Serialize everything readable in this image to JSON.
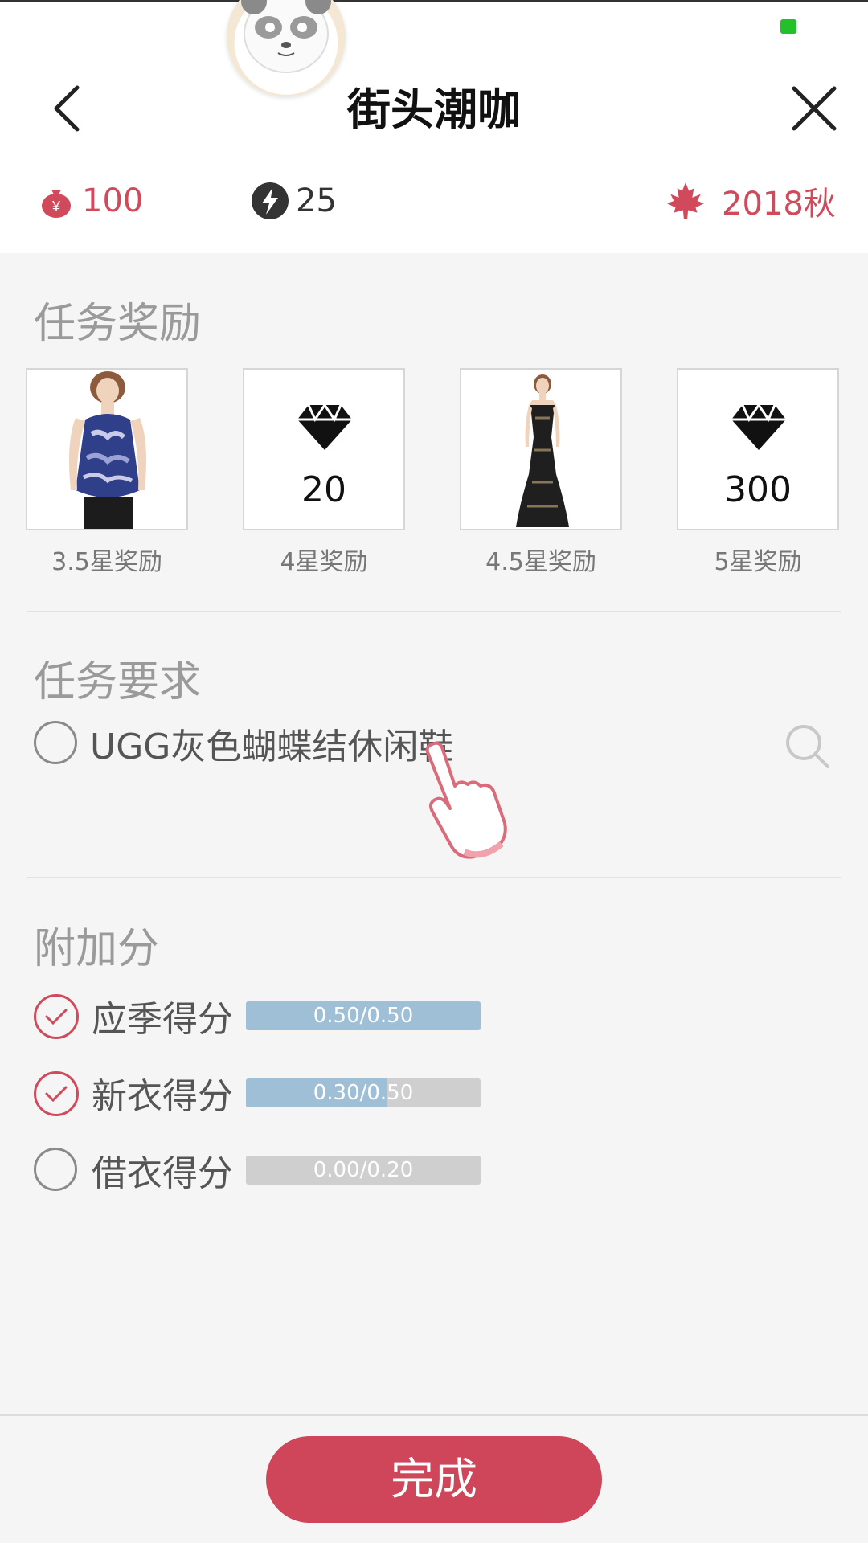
{
  "header": {
    "title": "街头潮咖",
    "back_icon": "chevron-left-icon",
    "close_icon": "close-icon",
    "avatar": "panda-avatar"
  },
  "stats": {
    "money": {
      "icon": "money-bag-icon",
      "value": "100"
    },
    "energy": {
      "icon": "lightning-icon",
      "value": "25"
    },
    "season": {
      "icon": "maple-leaf-icon",
      "value": "2018秋"
    }
  },
  "rewards": {
    "title": "任务奖励",
    "items": [
      {
        "type": "clothing",
        "image": "blue-halter-top",
        "label": "3.5星奖励"
      },
      {
        "type": "diamond",
        "icon": "diamond-icon",
        "amount": "20",
        "label": "4星奖励"
      },
      {
        "type": "clothing",
        "image": "black-sequin-gown",
        "label": "4.5星奖励"
      },
      {
        "type": "diamond",
        "icon": "diamond-icon",
        "amount": "300",
        "label": "5星奖励"
      }
    ]
  },
  "requirements": {
    "title": "任务要求",
    "items": [
      {
        "text": "UGG灰色蝴蝶结休闲鞋",
        "checked": false,
        "action_icon": "search-icon"
      }
    ]
  },
  "bonus": {
    "title": "附加分",
    "items": [
      {
        "label": "应季得分",
        "score": "0.50/0.50",
        "progress": 1.0,
        "checked": true
      },
      {
        "label": "新衣得分",
        "score": "0.30/0.50",
        "progress": 0.6,
        "checked": true
      },
      {
        "label": "借衣得分",
        "score": "0.00/0.20",
        "progress": 0.0,
        "checked": false
      }
    ]
  },
  "footer": {
    "done_label": "完成"
  },
  "colors": {
    "accent": "#cf4559",
    "progress": "#9fbfd6",
    "status": "#22c12a"
  }
}
